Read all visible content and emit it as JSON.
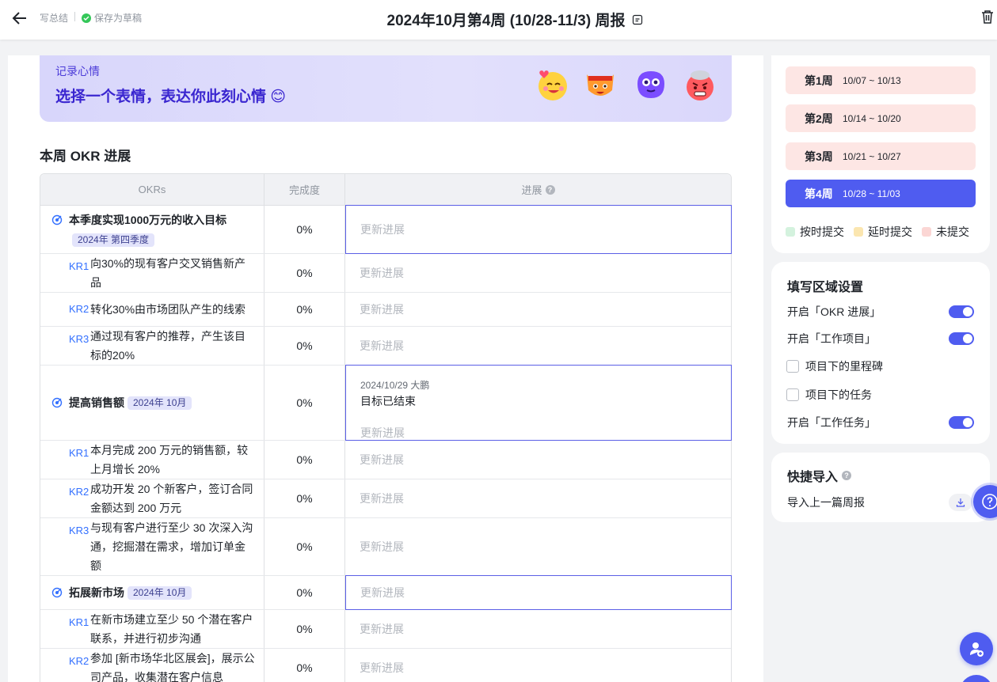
{
  "topbar": {
    "breadcrumb": "写总结",
    "saved_status": "保存为草稿",
    "title": "2024年10月第4周 (10/28-11/3) 周报"
  },
  "mood": {
    "label": "记录心情",
    "prompt": "选择一个表情，表达你此刻心情 😊",
    "faces": [
      "love-face-icon",
      "happy-cat-icon",
      "purple-blob-icon",
      "angry-face-icon"
    ]
  },
  "okr": {
    "heading": "本周 OKR 进展",
    "columns": [
      "OKRs",
      "完成度",
      "进展"
    ],
    "placeholder": "更新进展",
    "rows": [
      {
        "type": "objective",
        "text": "本季度实现1000万元的收入目标",
        "tag": "2024年 第四季度",
        "completion": "0%"
      },
      {
        "type": "kr",
        "label": "KR1",
        "text": "向30%的现有客户交叉销售新产品",
        "completion": "0%"
      },
      {
        "type": "kr",
        "label": "KR2",
        "text": "转化30%由市场团队产生的线索",
        "completion": "0%"
      },
      {
        "type": "kr",
        "label": "KR3",
        "text": "通过现有客户的推荐，产生该目标的20%",
        "completion": "0%"
      },
      {
        "type": "objective",
        "text": "提高销售额",
        "tag": "2024年 10月",
        "completion": "0%",
        "entry_meta": "2024/10/29 大鹏",
        "entry_text": "目标已结束"
      },
      {
        "type": "kr",
        "label": "KR1",
        "text": "本月完成 200 万元的销售额，较上月增长 20%",
        "completion": "0%"
      },
      {
        "type": "kr",
        "label": "KR2",
        "text": "成功开发 20 个新客户，签订合同金额达到 200 万元",
        "completion": "0%"
      },
      {
        "type": "kr",
        "label": "KR3",
        "text": "与现有客户进行至少 30 次深入沟通，挖掘潜在需求，增加订单金额",
        "completion": "0%"
      },
      {
        "type": "objective",
        "text": "拓展新市场",
        "tag": "2024年 10月",
        "completion": "0%"
      },
      {
        "type": "kr",
        "label": "KR1",
        "text": "在新市场建立至少 50 个潜在客户联系，并进行初步沟通",
        "completion": "0%"
      },
      {
        "type": "kr",
        "label": "KR2",
        "text": "参加 [新市场华北区展会]，展示公司产品，收集潜在客户信息",
        "completion": "0%"
      }
    ]
  },
  "weeks": {
    "items": [
      {
        "name": "第1周",
        "range": "10/07 ~ 10/13"
      },
      {
        "name": "第2周",
        "range": "10/14 ~ 10/20"
      },
      {
        "name": "第3周",
        "range": "10/21 ~ 10/27"
      },
      {
        "name": "第4周",
        "range": "10/28 ~ 11/03"
      }
    ],
    "legend": [
      {
        "label": "按时提交",
        "color": "#d4f2de"
      },
      {
        "label": "延时提交",
        "color": "#fbe6b0"
      },
      {
        "label": "未提交",
        "color": "#fbd6d4"
      }
    ]
  },
  "settings": {
    "title": "填写区域设置",
    "okr_toggle": "开启「OKR 进展」",
    "project_toggle": "开启「工作项目」",
    "milestone_check": "项目下的里程碑",
    "task_check": "项目下的任务",
    "task_toggle": "开启「工作任务」"
  },
  "import": {
    "title": "快捷导入",
    "last_report": "导入上一篇周报"
  },
  "colors": {
    "accent": "#4f5cf0",
    "kr_label": "#3370ff",
    "mood_text": "#3a26d0"
  }
}
